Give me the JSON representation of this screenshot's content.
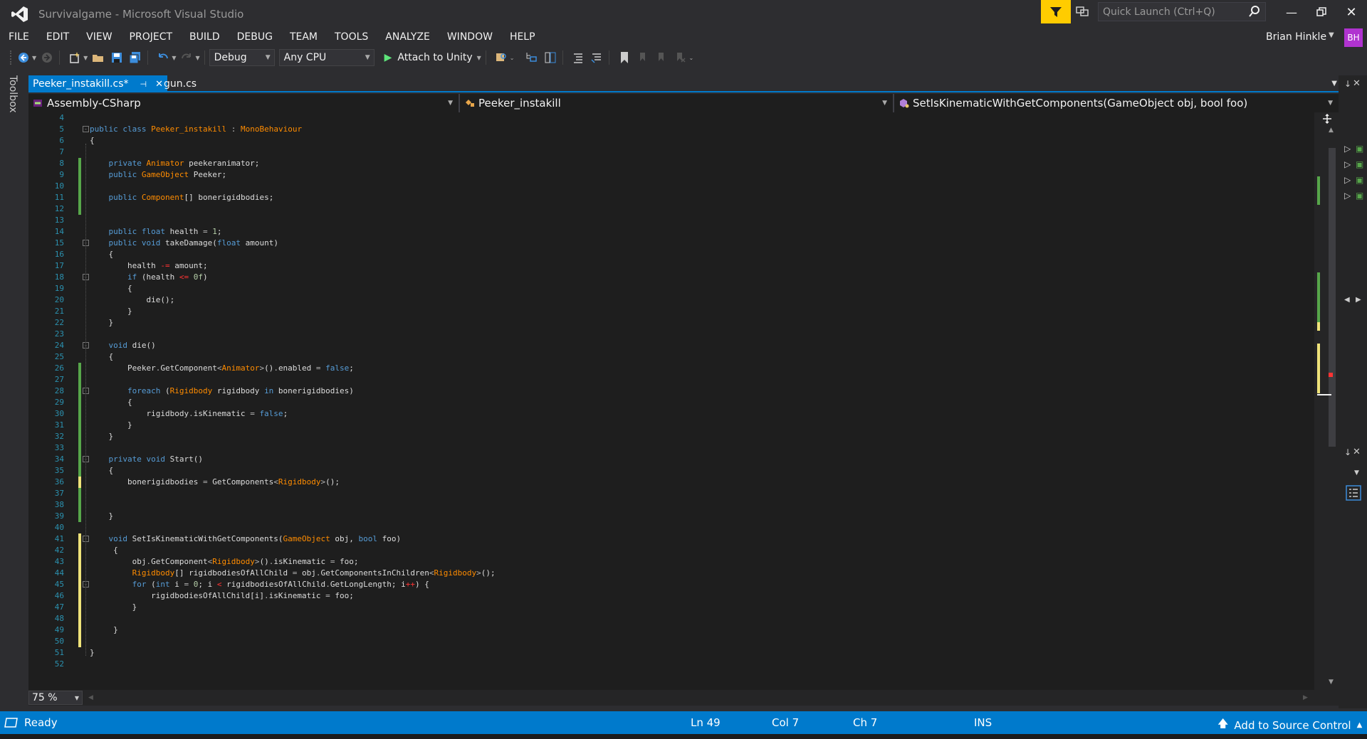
{
  "window": {
    "title": "Survivalgame - Microsoft Visual Studio",
    "quick_launch_placeholder": "Quick Launch (Ctrl+Q)",
    "user_name": "Brian Hinkle",
    "user_initials": "BH"
  },
  "menu": [
    "FILE",
    "EDIT",
    "VIEW",
    "PROJECT",
    "BUILD",
    "DEBUG",
    "TEAM",
    "TOOLS",
    "ANALYZE",
    "WINDOW",
    "HELP"
  ],
  "toolbar": {
    "config": "Debug",
    "platform": "Any CPU",
    "attach_label": "Attach to Unity"
  },
  "toolbox_label": "Toolbox",
  "tabs": [
    {
      "label": "Peeker_instakill.cs*",
      "active": true
    },
    {
      "label": "gun.cs",
      "active": false
    }
  ],
  "nav": {
    "project": "Assembly-CSharp",
    "class": "Peeker_instakill",
    "member": "SetIsKinematicWithGetComponents(GameObject obj, bool foo)"
  },
  "code_lines": [
    {
      "n": "4",
      "html": ""
    },
    {
      "n": "5",
      "html": "<span class='k'>public</span> <span class='k'>class</span> <span class='t'>Peeker_instakill</span> <span class='o'>:</span> <span class='t'>MonoBehaviour</span>"
    },
    {
      "n": "6",
      "html": "{"
    },
    {
      "n": "7",
      "html": ""
    },
    {
      "n": "8",
      "html": "    <span class='k'>private</span> <span class='t'>Animator</span> peekeranimator;"
    },
    {
      "n": "9",
      "html": "    <span class='k'>public</span> <span class='t'>GameObject</span> Peeker;"
    },
    {
      "n": "10",
      "html": ""
    },
    {
      "n": "11",
      "html": "    <span class='k'>public</span> <span class='t'>Component</span>[] bonerigidbodies;"
    },
    {
      "n": "12",
      "html": ""
    },
    {
      "n": "13",
      "html": ""
    },
    {
      "n": "14",
      "html": "    <span class='k'>public</span> <span class='k'>float</span> health <span class='o'>=</span> <span class='n'>1</span>;"
    },
    {
      "n": "15",
      "html": "    <span class='k'>public</span> <span class='k'>void</span> takeDamage(<span class='k'>float</span> amount)"
    },
    {
      "n": "16",
      "html": "    {"
    },
    {
      "n": "17",
      "html": "        health <span class='r'>-=</span> amount;"
    },
    {
      "n": "18",
      "html": "        <span class='k'>if</span> (health <span class='r'>&lt;=</span> <span class='n'>0f</span>)"
    },
    {
      "n": "19",
      "html": "        {"
    },
    {
      "n": "20",
      "html": "            die();"
    },
    {
      "n": "21",
      "html": "        }"
    },
    {
      "n": "22",
      "html": "    }"
    },
    {
      "n": "23",
      "html": ""
    },
    {
      "n": "24",
      "html": "    <span class='k'>void</span> die()"
    },
    {
      "n": "25",
      "html": "    {"
    },
    {
      "n": "26",
      "html": "        Peeker<span class='o'>.</span>GetComponent<span class='o'>&lt;</span><span class='t'>Animator</span><span class='o'>&gt;</span>()<span class='o'>.</span>enabled <span class='o'>=</span> <span class='k'>false</span>;"
    },
    {
      "n": "27",
      "html": ""
    },
    {
      "n": "28",
      "html": "        <span class='k'>foreach</span> (<span class='t'>Rigidbody</span> rigidbody <span class='k'>in</span> bonerigidbodies)"
    },
    {
      "n": "29",
      "html": "        {"
    },
    {
      "n": "30",
      "html": "            rigidbody<span class='o'>.</span>isKinematic <span class='o'>=</span> <span class='k'>false</span>;"
    },
    {
      "n": "31",
      "html": "        }"
    },
    {
      "n": "32",
      "html": "    }"
    },
    {
      "n": "33",
      "html": ""
    },
    {
      "n": "34",
      "html": "    <span class='k'>private</span> <span class='k'>void</span> Start()"
    },
    {
      "n": "35",
      "html": "    {"
    },
    {
      "n": "36",
      "html": "        bonerigidbodies <span class='o'>=</span> GetComponents<span class='o'>&lt;</span><span class='t'>Rigidbody</span><span class='o'>&gt;</span>();"
    },
    {
      "n": "37",
      "html": ""
    },
    {
      "n": "38",
      "html": ""
    },
    {
      "n": "39",
      "html": "    }"
    },
    {
      "n": "40",
      "html": ""
    },
    {
      "n": "41",
      "html": "    <span class='k'>void</span> SetIsKinematicWithGetComponents(<span class='t'>GameObject</span> obj, <span class='k'>bool</span> foo)"
    },
    {
      "n": "42",
      "html": "     {"
    },
    {
      "n": "43",
      "html": "         obj<span class='o'>.</span>GetComponent<span class='o'>&lt;</span><span class='t'>Rigidbody</span><span class='o'>&gt;</span>()<span class='o'>.</span>isKinematic <span class='o'>=</span> foo;"
    },
    {
      "n": "44",
      "html": "         <span class='t'>Rigidbody</span>[] rigidbodiesOfAllChild <span class='o'>=</span> obj<span class='o'>.</span>GetComponentsInChildren<span class='o'>&lt;</span><span class='t'>Rigidbody</span><span class='o'>&gt;</span>();"
    },
    {
      "n": "45",
      "html": "         <span class='k'>for</span> (<span class='k'>int</span> i <span class='o'>=</span> <span class='n'>0</span>; i <span class='r'>&lt;</span> rigidbodiesOfAllChild<span class='o'>.</span>GetLongLength; i<span class='r'>++</span>) {"
    },
    {
      "n": "46",
      "html": "             rigidbodiesOfAllChild[i]<span class='o'>.</span>isKinematic <span class='o'>=</span> foo;"
    },
    {
      "n": "47",
      "html": "         }"
    },
    {
      "n": "48",
      "html": ""
    },
    {
      "n": "49",
      "html": "     }"
    },
    {
      "n": "50",
      "html": ""
    },
    {
      "n": "51",
      "html": "}"
    },
    {
      "n": "52",
      "html": ""
    }
  ],
  "zoom": "75 %",
  "status": {
    "state": "Ready",
    "ln": "Ln 49",
    "col": "Col 7",
    "ch": "Ch 7",
    "ins": "INS",
    "source_control": "Add to Source Control"
  },
  "colors": {
    "accent": "#007acc",
    "background": "#2d2d30",
    "editor": "#1e1e1e",
    "keyword": "#569cd6",
    "type": "#ff8c00",
    "change_saved": "#57a64a",
    "change_unsaved": "#efe37a"
  }
}
